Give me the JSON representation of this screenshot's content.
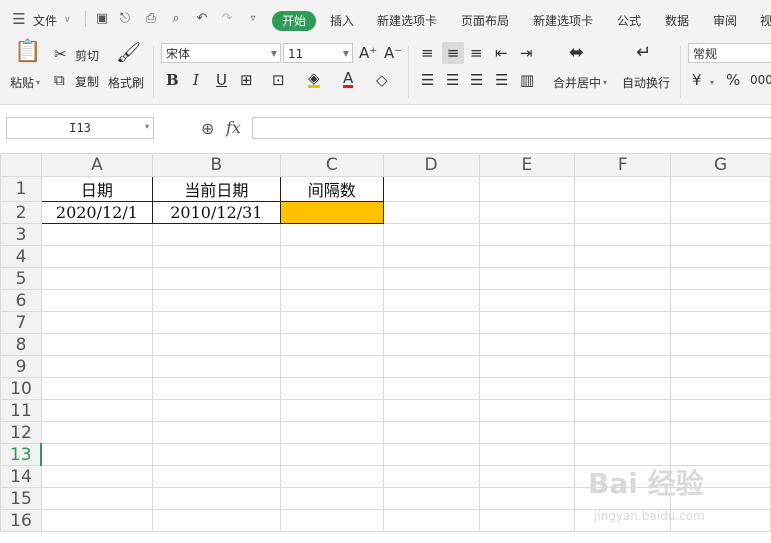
{
  "menubar": {
    "file_label": "文件",
    "tabs": [
      "开始",
      "插入",
      "新建选项卡",
      "页面布局",
      "新建选项卡",
      "公式",
      "数据",
      "审阅",
      "视"
    ],
    "active_tab": "开始"
  },
  "ribbon": {
    "paste": "粘贴",
    "cut": "剪切",
    "copy": "复制",
    "format_painter": "格式刷",
    "font_name": "宋体",
    "font_size": "11",
    "bold": "B",
    "italic": "I",
    "underline": "U",
    "merge_center": "合并居中",
    "wrap_text": "自动换行",
    "number_format": "常规",
    "currency": "¥",
    "percent": "%",
    "thousands": "000"
  },
  "formula_bar": {
    "name_box": "I13",
    "fx": "fx",
    "value": ""
  },
  "sheet": {
    "columns": [
      "A",
      "B",
      "C",
      "D",
      "E",
      "F",
      "G"
    ],
    "rows": [
      "1",
      "2",
      "3",
      "4",
      "5",
      "6",
      "7",
      "8",
      "9",
      "10",
      "11",
      "12",
      "13",
      "14",
      "15",
      "16"
    ],
    "selected_row": "13",
    "cells": {
      "A1": "日期",
      "B1": "当前日期",
      "C1": "间隔数",
      "A2": "2020/12/1",
      "B2": "2010/12/31",
      "C2": ""
    },
    "highlight_color": "#ffc000"
  },
  "watermark": {
    "main": "Bai 经验",
    "sub": "jingyan.baidu.com"
  },
  "colors": {
    "accent": "#2e9b57"
  }
}
